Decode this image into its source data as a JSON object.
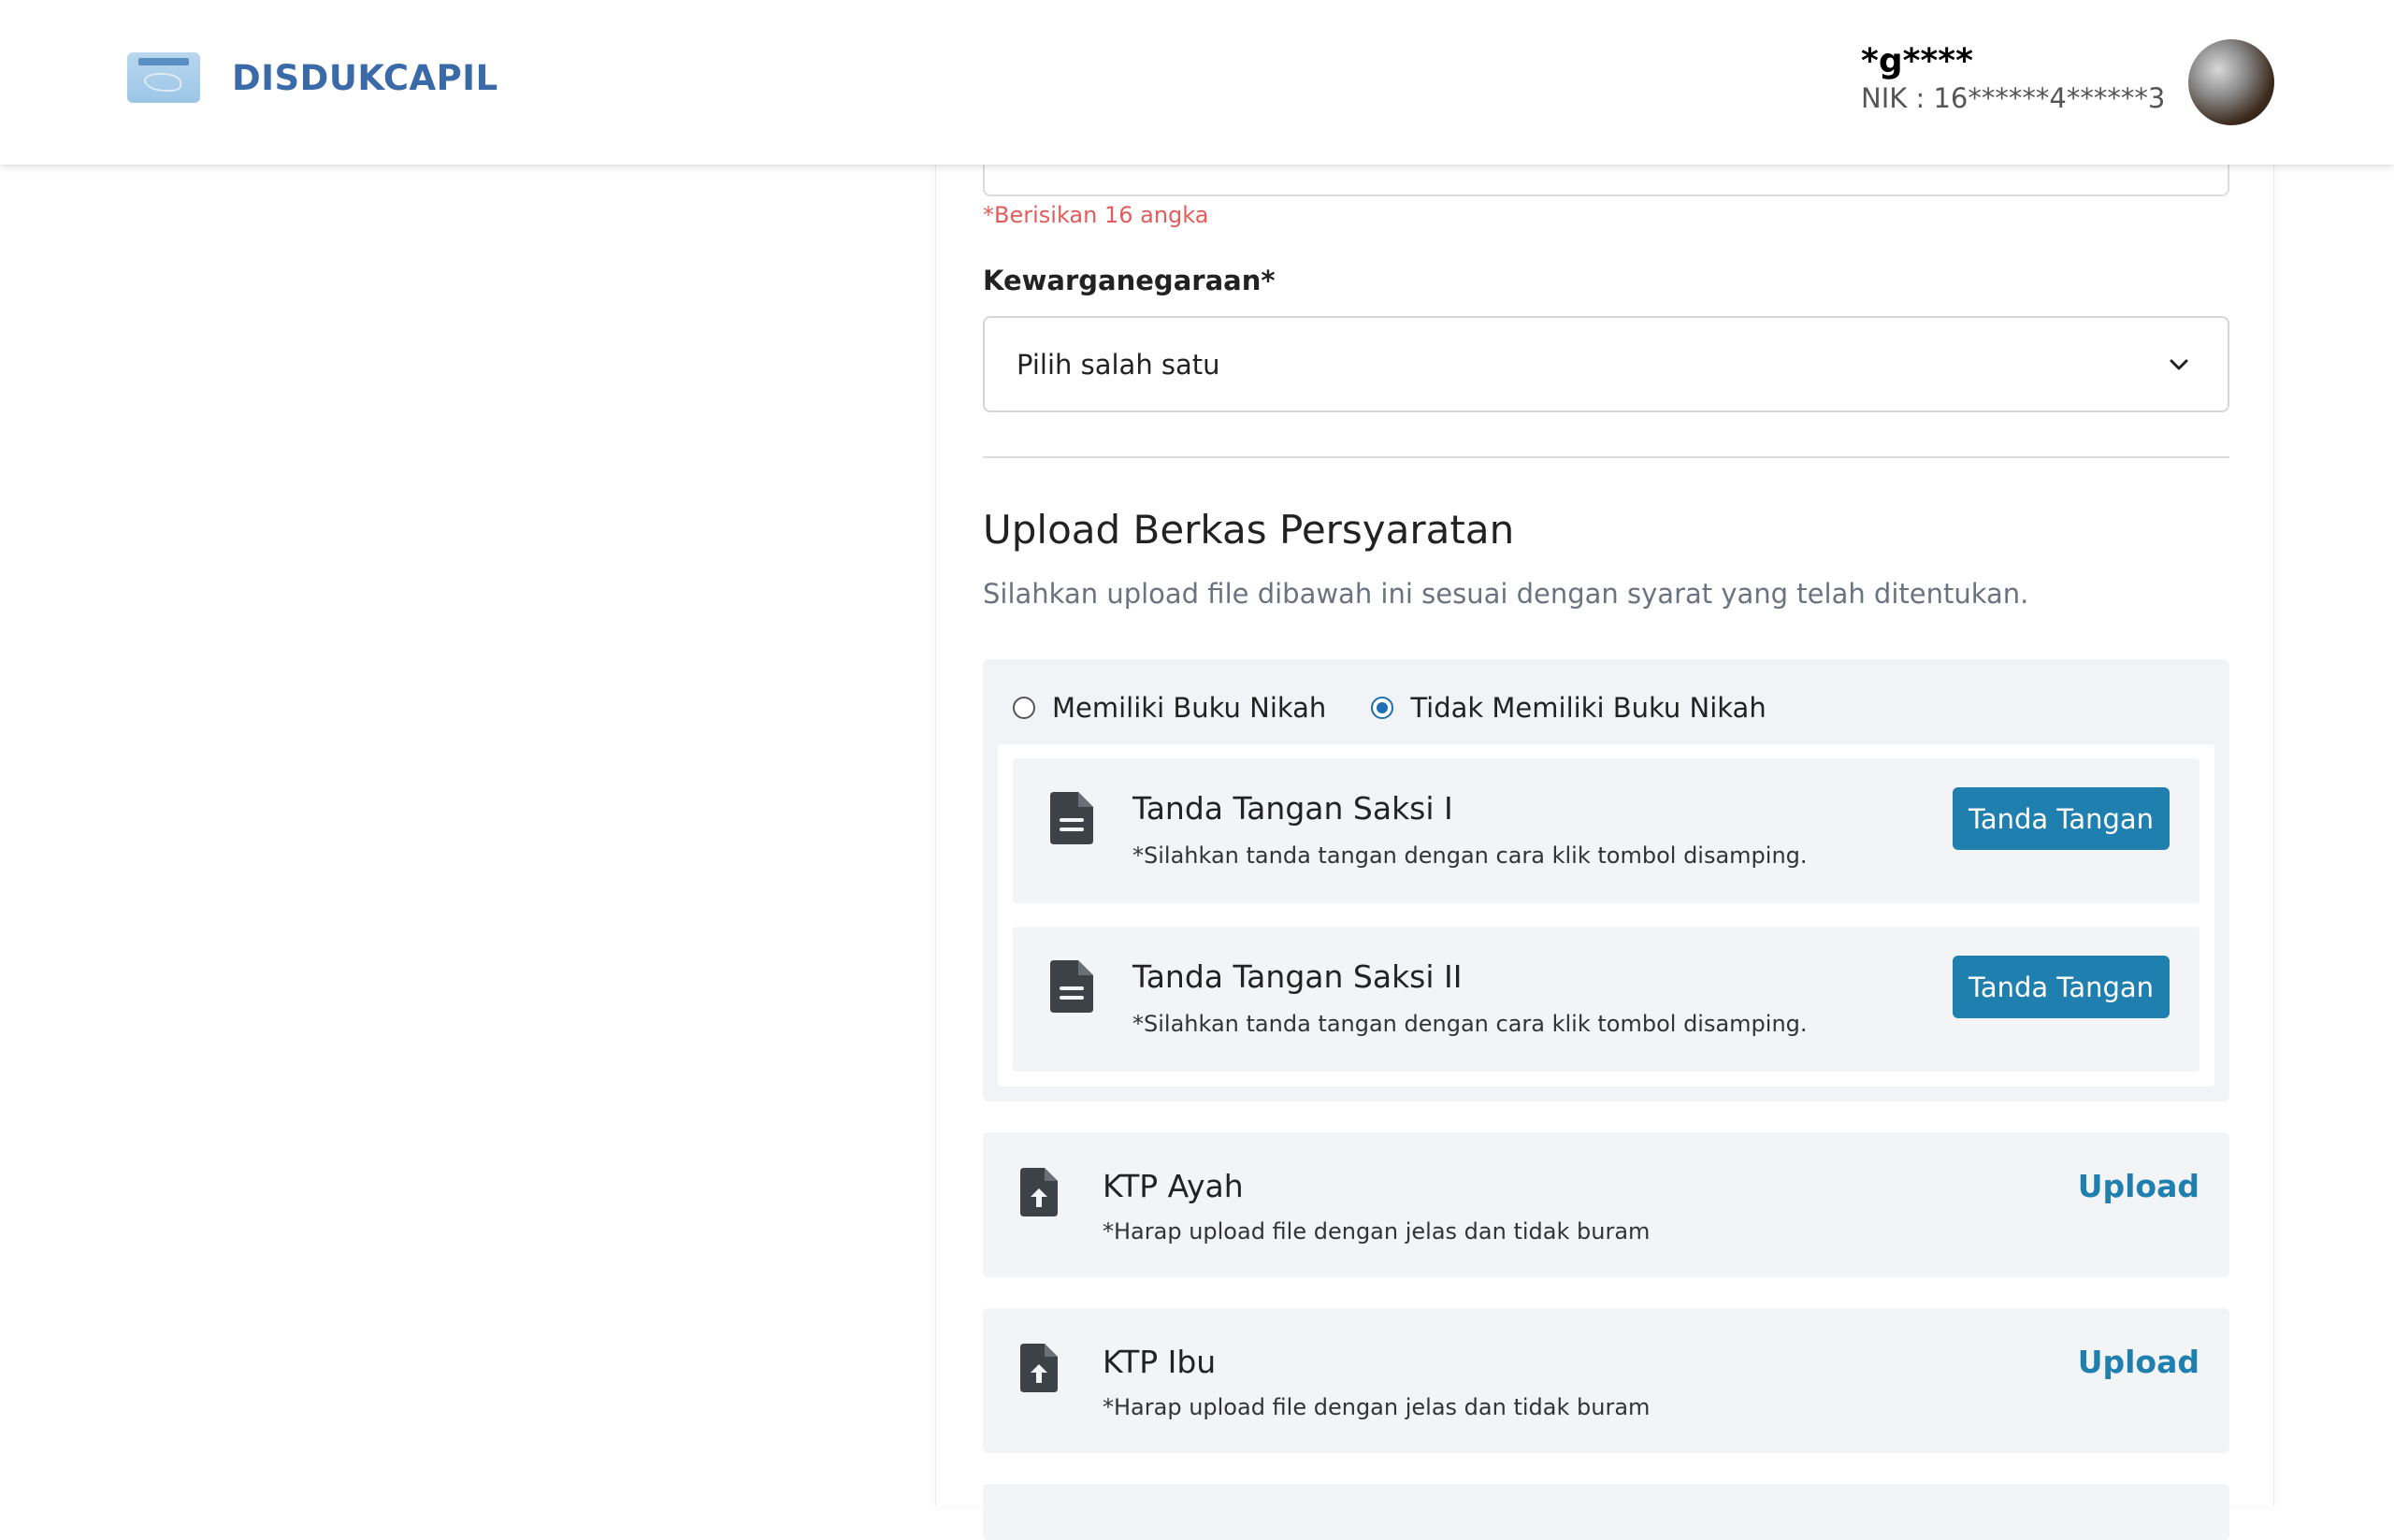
{
  "header": {
    "brand_name": "DISDUKCAPIL",
    "user_name": "*g****",
    "user_nik": "NIK : 16******4******3"
  },
  "form": {
    "nik_hint": "*Berisikan 16 angka",
    "citizenship_label": "Kewarganegaraan*",
    "citizenship_value": "Pilih salah satu"
  },
  "upload_section": {
    "title": "Upload Berkas Persyaratan",
    "subtitle": "Silahkan upload file dibawah ini sesuai dengan syarat yang telah ditentukan."
  },
  "marriage_options": {
    "selected": "Tidak Memiliki Buku Nikah",
    "options": [
      {
        "label": "Memiliki Buku Nikah"
      },
      {
        "label": "Tidak Memiliki Buku Nikah"
      }
    ]
  },
  "signatures": [
    {
      "title": "Tanda Tangan Saksi I",
      "note": "*Silahkan tanda tangan dengan cara klik tombol disamping.",
      "button": "Tanda Tangan"
    },
    {
      "title": "Tanda Tangan Saksi II",
      "note": "*Silahkan tanda tangan dengan cara klik tombol disamping.",
      "button": "Tanda Tangan"
    }
  ],
  "uploads": [
    {
      "title": "KTP Ayah",
      "note": "*Harap upload file dengan jelas dan tidak buram",
      "action": "Upload"
    },
    {
      "title": "KTP Ibu",
      "note": "*Harap upload file dengan jelas dan tidak buram",
      "action": "Upload"
    }
  ],
  "icons": {
    "brand": "ktp-card-logo",
    "select_chevron": "chevron-down-icon",
    "signature_doc": "file-text-icon",
    "upload_doc": "file-upload-icon"
  },
  "colors": {
    "brand": "#3a6aa8",
    "primary": "#1f7fae",
    "hint_red": "#e25c5c",
    "radio_checked": "#1f6fb3"
  }
}
